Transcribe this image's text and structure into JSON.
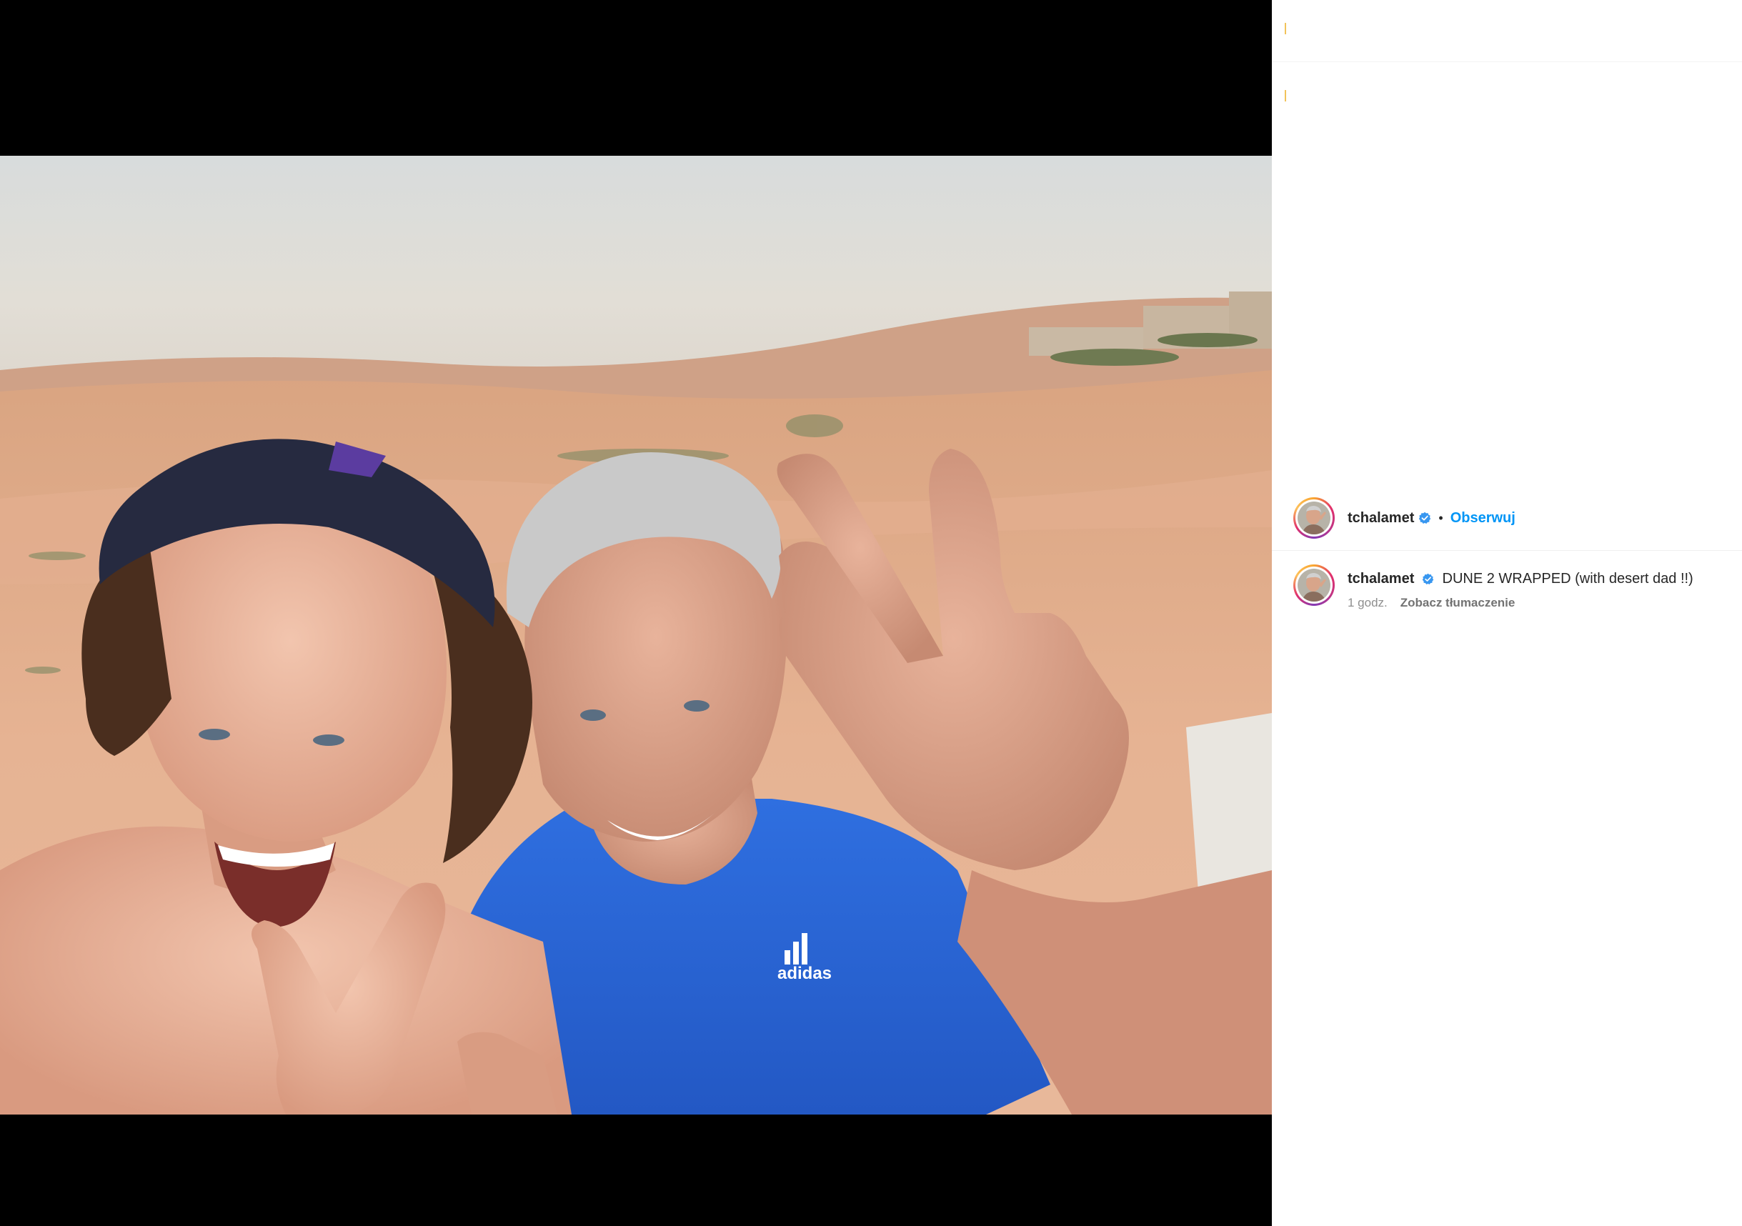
{
  "post": {
    "username": "tchalamet",
    "follow_label": "Obserwuj",
    "separator": "•",
    "verified_icon": "verified-badge-icon",
    "caption": {
      "username": "tchalamet",
      "text": "DUNE 2 WRAPPED (with desert dad !!)",
      "time": "1 godz.",
      "translate_label": "Zobacz tłumaczenie"
    },
    "photo_logo_text": "adidas"
  },
  "colors": {
    "follow_blue": "#0095f6",
    "verified_blue": "#3897f0",
    "text_primary": "#262626",
    "text_secondary": "#8e8e8e",
    "media_background": "#000000"
  }
}
